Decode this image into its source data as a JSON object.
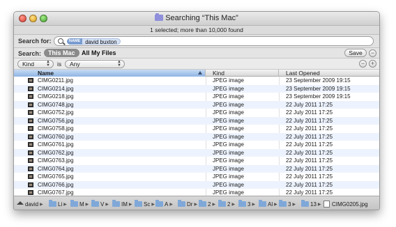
{
  "window": {
    "title": "Searching “This Mac”",
    "status": "1 selected; more than 10,000 found"
  },
  "search": {
    "label": "Search for:",
    "token_name": "NAME",
    "token_value": "david buxton"
  },
  "scope": {
    "label": "Search:",
    "this_mac": "This Mac",
    "all_files": "All My Files",
    "save": "Save",
    "minus": "−"
  },
  "criteria": {
    "attribute": "Kind",
    "operator": "is",
    "value": "Any",
    "minus": "−",
    "plus": "+"
  },
  "table": {
    "headers": {
      "name": "Name",
      "kind": "Kind",
      "last_opened": "Last Opened"
    },
    "rows": [
      {
        "name": "CIMG0211.jpg",
        "kind": "JPEG image",
        "last": "23 September 2009 19:15"
      },
      {
        "name": "CIMG0214.jpg",
        "kind": "JPEG image",
        "last": "23 September 2009 19:15"
      },
      {
        "name": "CIMG0218.jpg",
        "kind": "JPEG image",
        "last": "23 September 2009 19:15"
      },
      {
        "name": "CIMG0748.jpg",
        "kind": "JPEG image",
        "last": "22 July 2011 17:25"
      },
      {
        "name": "CIMG0752.jpg",
        "kind": "JPEG image",
        "last": "22 July 2011 17:25"
      },
      {
        "name": "CIMG0756.jpg",
        "kind": "JPEG image",
        "last": "22 July 2011 17:25"
      },
      {
        "name": "CIMG0758.jpg",
        "kind": "JPEG image",
        "last": "22 July 2011 17:25"
      },
      {
        "name": "CIMG0760.jpg",
        "kind": "JPEG image",
        "last": "22 July 2011 17:25"
      },
      {
        "name": "CIMG0761.jpg",
        "kind": "JPEG image",
        "last": "22 July 2011 17:25"
      },
      {
        "name": "CIMG0762.jpg",
        "kind": "JPEG image",
        "last": "22 July 2011 17:25"
      },
      {
        "name": "CIMG0763.jpg",
        "kind": "JPEG image",
        "last": "22 July 2011 17:25"
      },
      {
        "name": "CIMG0764.jpg",
        "kind": "JPEG image",
        "last": "22 July 2011 17:25"
      },
      {
        "name": "CIMG0765.jpg",
        "kind": "JPEG image",
        "last": "22 July 2011 17:25"
      },
      {
        "name": "CIMG0766.jpg",
        "kind": "JPEG image",
        "last": "22 July 2011 17:25"
      },
      {
        "name": "CIMG0767.jpg",
        "kind": "JPEG image",
        "last": "22 July 2011 17:25"
      }
    ]
  },
  "pathbar": {
    "items": [
      "david",
      "Li",
      "M",
      "V",
      "IM",
      "Sc",
      "A",
      "Dr",
      "2",
      "2",
      "3",
      "Al",
      "3",
      "13",
      "CIMG0205.jpg"
    ]
  },
  "colors": {
    "selected_header": "#8fb4e4",
    "alt_row": "#edf3fe",
    "token": "#7a9ccf"
  }
}
